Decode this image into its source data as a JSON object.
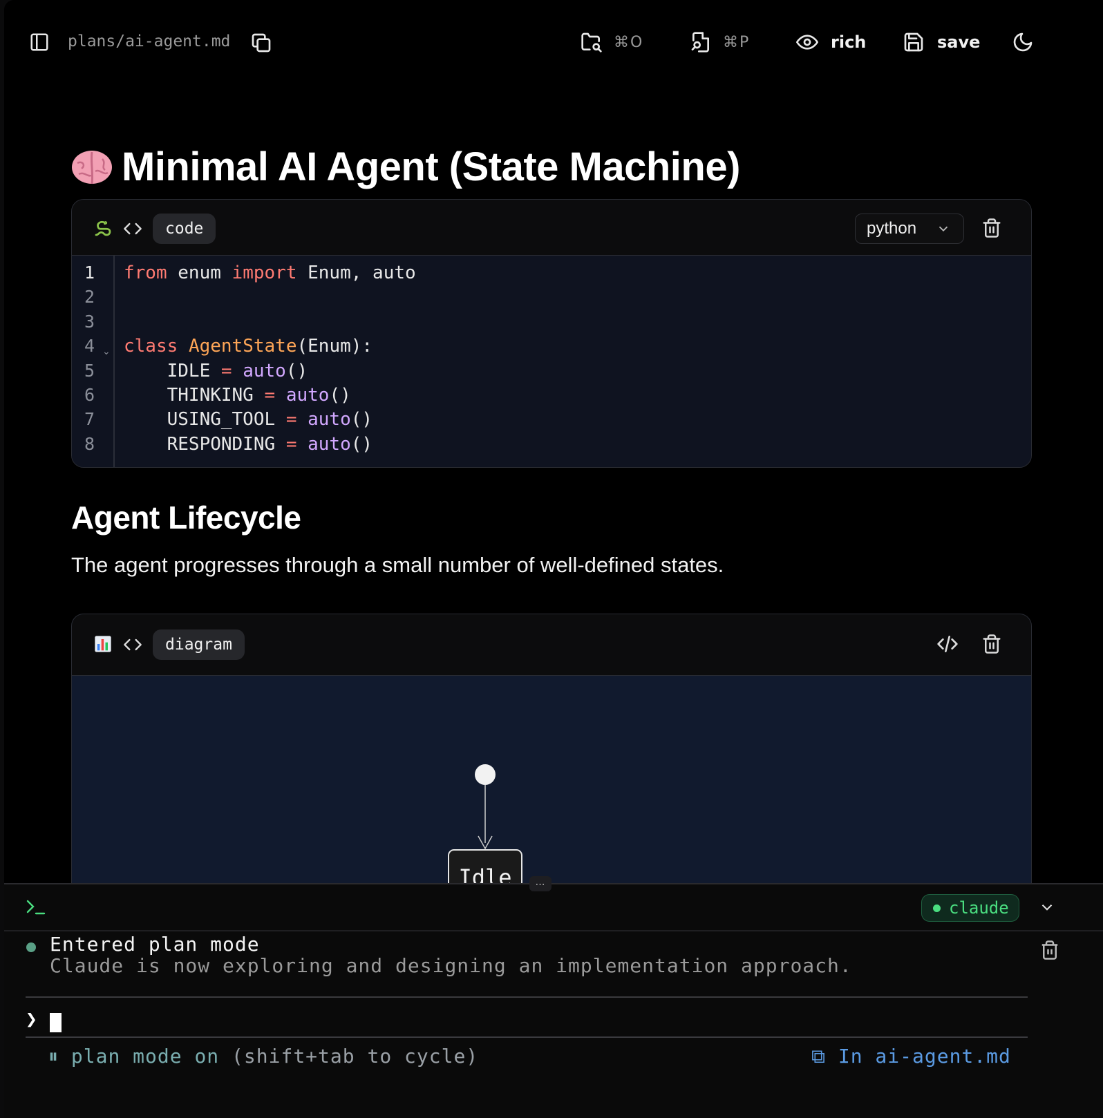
{
  "toolbar": {
    "file_path": "plans/ai-agent.md",
    "open_shortcut": "⌘O",
    "palette_shortcut": "⌘P",
    "view_mode": "rich",
    "save_label": "save"
  },
  "document": {
    "title": "Minimal AI Agent (State Machine)",
    "title_emoji": "brain",
    "code_block": {
      "type_icon": "snake",
      "chip_label": "code",
      "language": "python",
      "line_numbers": [
        "1",
        "2",
        "3",
        "4",
        "5",
        "6",
        "7",
        "8"
      ],
      "lines": [
        "from enum import Enum, auto",
        "",
        "",
        "class AgentState(Enum):",
        "    IDLE = auto()",
        "    THINKING = auto()",
        "    USING_TOOL = auto()",
        "    RESPONDING = auto()"
      ]
    },
    "section_heading": "Agent Lifecycle",
    "section_paragraph": "The agent progresses through a small number of well-defined states.",
    "diagram_block": {
      "type_icon": "bar-chart",
      "chip_label": "diagram",
      "nodes": [
        "Idle"
      ]
    }
  },
  "terminal": {
    "prompt_icon": "terminal-prompt",
    "agent_name": "claude",
    "message_title": "Entered plan mode",
    "message_body": "Claude is now exploring and designing an implementation approach.",
    "prompt_symbol": "❯",
    "status_prefix": "⏸",
    "status_mode": "plan mode on",
    "status_hint": "(shift+tab to cycle)",
    "context_icon": "⧉",
    "context_label": "In ai-agent.md"
  },
  "colors": {
    "keyword": "#ff7b72",
    "class_name": "#ffa657",
    "function": "#d2a8ff",
    "agent_green": "#4ade80",
    "context_blue": "#5b9be3"
  }
}
